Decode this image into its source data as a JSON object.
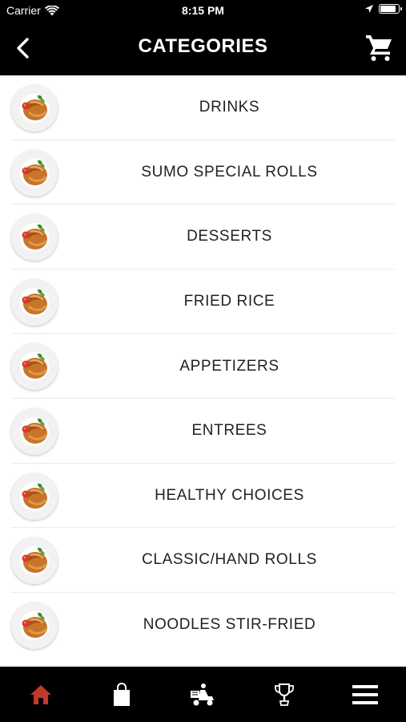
{
  "status_bar": {
    "carrier": "Carrier",
    "time": "8:15 PM",
    "battery_level": 0.9
  },
  "nav": {
    "title": "CATEGORIES"
  },
  "categories": [
    {
      "label": "DRINKS"
    },
    {
      "label": "SUMO SPECIAL ROLLS"
    },
    {
      "label": "DESSERTS"
    },
    {
      "label": "FRIED RICE"
    },
    {
      "label": "APPETIZERS"
    },
    {
      "label": "ENTREES"
    },
    {
      "label": "HEALTHY CHOICES"
    },
    {
      "label": "CLASSIC/HAND ROLLS"
    },
    {
      "label": "NOODLES STIR-FRIED"
    }
  ],
  "tabs": [
    {
      "icon": "home-icon",
      "active": true
    },
    {
      "icon": "shopping-bag-icon",
      "active": false
    },
    {
      "icon": "delivery-icon",
      "active": false
    },
    {
      "icon": "trophy-icon",
      "active": false
    },
    {
      "icon": "menu-icon",
      "active": false
    }
  ],
  "colors": {
    "active_tab": "#c0392b",
    "bar_bg": "#000000",
    "icon": "#ffffff"
  }
}
